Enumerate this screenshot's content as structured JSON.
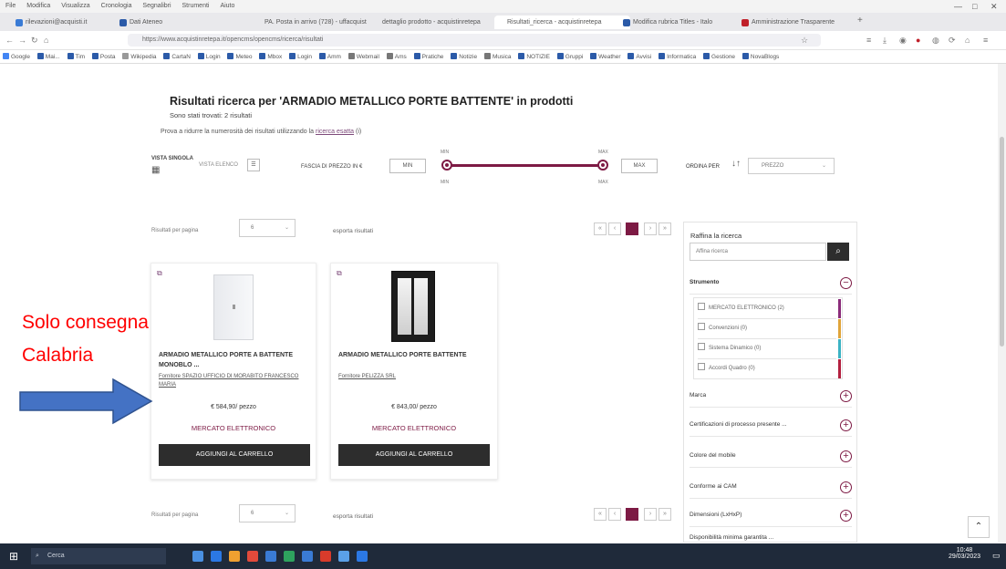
{
  "browser": {
    "menu": [
      "File",
      "Modifica",
      "Visualizza",
      "Cronologia",
      "Segnalibri",
      "Strumenti",
      "Aiuto"
    ],
    "tabs": [
      "rilevazioni@acquisti.it",
      "Dati Ateneo",
      "PA. Posta in arrivo (728) - uffacquist",
      "dettaglio prodotto - acquistinretepa",
      "Risultati_ricerca - acquistinretepa",
      "Modifica rubrica Titles - Italo",
      "Amministrazione Trasparente"
    ],
    "url": "https://www.acquistinretepa.it/opencms/opencms/ricerca/risultati",
    "bookmarks": [
      "Google",
      "Mai...",
      "Tim",
      "Posta",
      "Wikipedia",
      "CartaN",
      "Login",
      "Meteo",
      "Mbox",
      "Login",
      "Amm",
      "Webmail",
      "Ams",
      "Pratiche",
      "Notizie",
      "Musica",
      "NOTIZIE",
      "Gruppi",
      "Weather",
      "Avvisi",
      "Informatica",
      "Gestione",
      "NovaBlogs"
    ]
  },
  "page": {
    "title": "Risultati ricerca per 'ARMADIO METALLICO PORTE BATTENTE' in prodotti",
    "found": "Sono stati trovati: 2 risultati",
    "hint_prefix": "Prova a ridurre la numerosità dei risultati utilizzando la ",
    "hint_link": "ricerca esatta",
    "hint_suffix": " (i)"
  },
  "toolbar": {
    "view_single": "VISTA SINGOLA",
    "view_list": "VISTA ELENCO",
    "price_range_label": "FASCIA DI PREZZO IN €",
    "min_btn": "MIN",
    "max_btn": "MAX",
    "min_label_top": "MIN",
    "min_label_bottom": "MIN",
    "max_label_top": "MAX",
    "max_label_bottom": "MAX",
    "order_label": "ORDINA PER",
    "order_value": "PREZZO"
  },
  "results": {
    "per_page_label": "Risultati per pagina",
    "per_page_value": "6",
    "export_label": "esporta risultati",
    "current_page": "1",
    "prev": "‹",
    "next": "›",
    "first": "«",
    "last": "»"
  },
  "products": [
    {
      "title": "ARMADIO METALLICO PORTE A BATTENTE MONOBLO ...",
      "seller": "Fornitore SPAZIO UFFICIO DI MORABITO FRANCESCO MARIA",
      "price": "€ 584,90/ pezzo",
      "market": "MERCATO ELETTRONICO",
      "button": "AGGIUNGI AL CARRELLO"
    },
    {
      "title": "ARMADIO METALLICO PORTE BATTENTE",
      "seller": "Fornitore PELIZZA SRL",
      "price": "€ 843,00/ pezzo",
      "market": "MERCATO ELETTRONICO",
      "button": "AGGIUNGI AL CARRELLO"
    }
  ],
  "sidebar": {
    "title": "Raffina la ricerca",
    "search_placeholder": "Affina ricerca",
    "tool_header": "Strumento",
    "filters": [
      "MERCATO ELETTRONICO (2)",
      "Convenzioni (0)",
      "Sistema Dinamico (0)",
      "Accordi Quadro (0)"
    ],
    "filter_colors": [
      "#8b2c7a",
      "#e0a43a",
      "#3bb3c4",
      "#b3203f"
    ],
    "sections": [
      "Marca",
      "Certificazioni di processo presente ...",
      "Colore del mobile",
      "Conforme ai CAM",
      "Dimensioni (LxHxP)",
      "Disponibilità minima garantita ..."
    ]
  },
  "annotation": {
    "line1": "Solo consegna",
    "line2": "Calabria",
    "color": "#ff0000",
    "arrow_color": "#4472c4"
  },
  "taskbar": {
    "search": "Cerca",
    "time": "10:48",
    "date": "29/03/2023"
  }
}
